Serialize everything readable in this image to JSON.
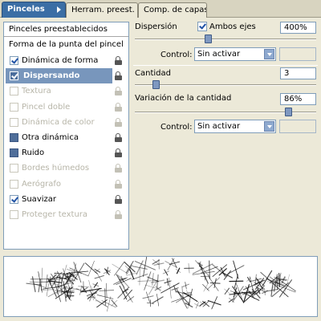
{
  "tabs": [
    {
      "label": "Pinceles",
      "active": true
    },
    {
      "label": "Herram. preest.",
      "active": false
    },
    {
      "label": "Comp. de capas",
      "active": false
    }
  ],
  "left_panel": {
    "header_presets": "Pinceles preestablecidos",
    "header_tip_shape": "Forma de la punta del pincel",
    "items": [
      {
        "label": "Dinámica de forma",
        "checked": true,
        "enabled": true,
        "selected": false,
        "lock_icon": "lock-open-icon"
      },
      {
        "label": "Dispersando",
        "checked": true,
        "enabled": true,
        "selected": true,
        "lock_icon": "lock-open-icon"
      },
      {
        "label": "Textura",
        "checked": false,
        "enabled": false,
        "selected": false,
        "lock_icon": "lock-icon"
      },
      {
        "label": "Pincel doble",
        "checked": false,
        "enabled": false,
        "selected": false,
        "lock_icon": "lock-icon"
      },
      {
        "label": "Dinámica de color",
        "checked": false,
        "enabled": false,
        "selected": false,
        "lock_icon": "lock-icon"
      },
      {
        "label": "Otra dinámica",
        "checked": false,
        "enabled": true,
        "selected": false,
        "lock_icon": "lock-open-icon"
      },
      {
        "label": "Ruido",
        "checked": false,
        "enabled": true,
        "selected": false,
        "lock_icon": "lock-open-icon"
      },
      {
        "label": "Bordes húmedos",
        "checked": false,
        "enabled": false,
        "selected": false,
        "lock_icon": "lock-icon"
      },
      {
        "label": "Aerógrafo",
        "checked": false,
        "enabled": false,
        "selected": false,
        "lock_icon": "lock-icon"
      },
      {
        "label": "Suavizar",
        "checked": true,
        "enabled": true,
        "selected": false,
        "lock_icon": "lock-open-icon"
      },
      {
        "label": "Proteger textura",
        "checked": false,
        "enabled": false,
        "selected": false,
        "lock_icon": "lock-icon"
      }
    ]
  },
  "scatter": {
    "label": "Dispersión",
    "both_axes_label": "Ambos ejes",
    "both_axes_checked": true,
    "value": "400%",
    "slider_fraction": 0.4,
    "control_label": "Control:",
    "control_value": "Sin activar"
  },
  "count": {
    "label": "Cantidad",
    "value": "3",
    "slider_fraction": 0.1
  },
  "count_jitter": {
    "label": "Variación de la cantidad",
    "value": "86%",
    "slider_fraction": 0.86,
    "control_label": "Control:",
    "control_value": "Sin activar"
  },
  "colors": {
    "accent": "#3b6ea5",
    "selection": "#7896bc",
    "disabled_text": "#b7b5a8",
    "panel_bg": "#ece9d8"
  }
}
